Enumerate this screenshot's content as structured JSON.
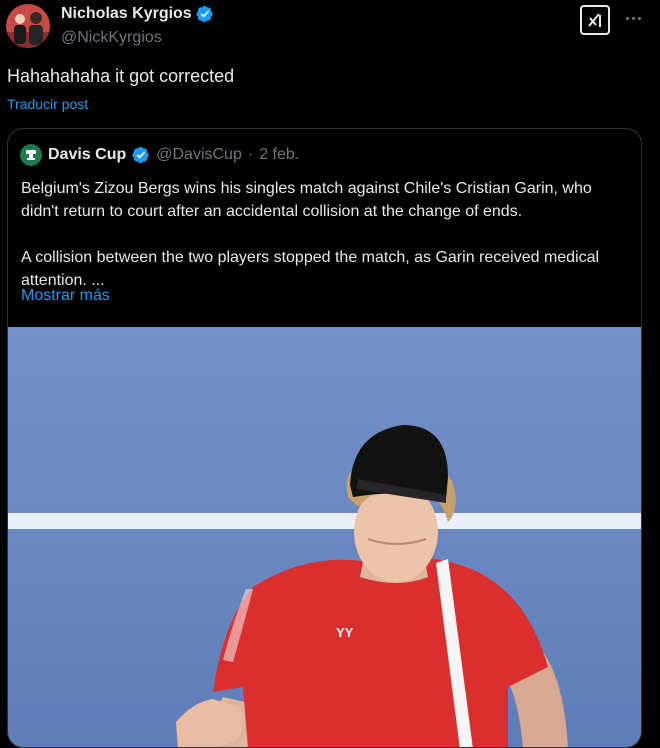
{
  "post": {
    "author": {
      "name": "Nicholas Kyrgios",
      "handle": "@NickKyrgios",
      "avatar_icon": "avatar-photo",
      "verified_icon": "verified-badge-icon"
    },
    "text": "Hahahahaha it got corrected",
    "translate_label": "Traducir post",
    "actions": {
      "grok_icon": "grok-icon",
      "more_icon": "more-options-icon"
    }
  },
  "quoted": {
    "author": {
      "name": "Davis Cup",
      "handle": "@DavisCup",
      "separator": "·",
      "date": "2 feb.",
      "avatar_icon": "davis-cup-logo",
      "verified_icon": "verified-badge-icon"
    },
    "paragraphs": [
      "Belgium's Zizou Bergs wins his singles match against Chile's Cristian Garin, who didn't return to court after an accidental collision at the change of ends.",
      "A collision between the two players stopped the match, as Garin received medical attention. ..."
    ],
    "show_more_label": "Mostrar más",
    "media": {
      "icon": "tennis-player-photo"
    }
  },
  "colors": {
    "background": "#000000",
    "text": "#e7e9ea",
    "muted": "#71767b",
    "link": "#1d9bf0",
    "border": "#2f3336",
    "verified": "#1d9bf0",
    "court": "#6a86c0",
    "shirt": "#d9302f"
  }
}
